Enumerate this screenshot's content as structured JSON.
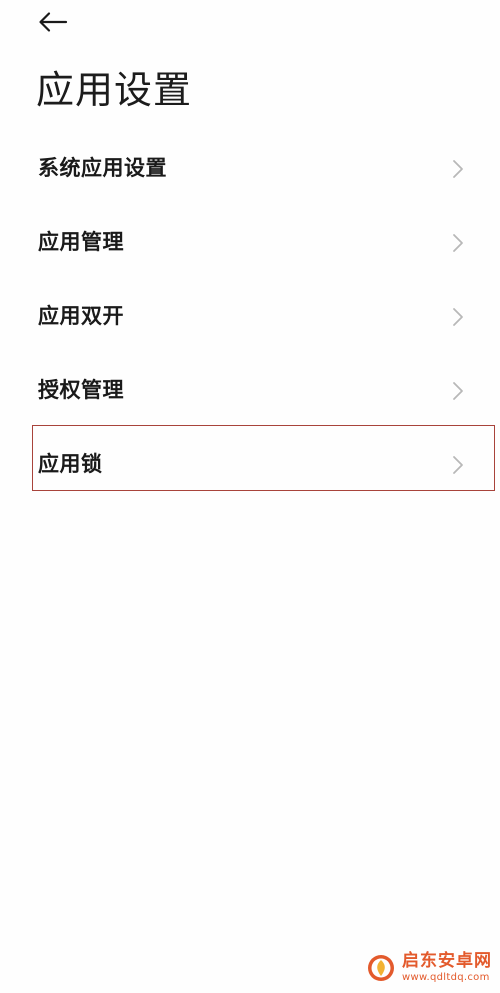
{
  "header": {
    "back_icon": "arrow-left-icon",
    "title": "应用设置"
  },
  "menu": {
    "items": [
      {
        "label": "系统应用设置",
        "icon": "chevron-right-icon"
      },
      {
        "label": "应用管理",
        "icon": "chevron-right-icon"
      },
      {
        "label": "应用双开",
        "icon": "chevron-right-icon"
      },
      {
        "label": "授权管理",
        "icon": "chevron-right-icon"
      },
      {
        "label": "应用锁",
        "icon": "chevron-right-icon",
        "highlighted": true
      }
    ]
  },
  "watermark": {
    "name": "启东安卓网",
    "url": "www.qdltdq.com",
    "color": "#e35a2c"
  },
  "colors": {
    "background": "#fefefe",
    "text": "#1a1a1a",
    "chevron": "#b8b8b8",
    "highlight_border": "#a8433b"
  }
}
